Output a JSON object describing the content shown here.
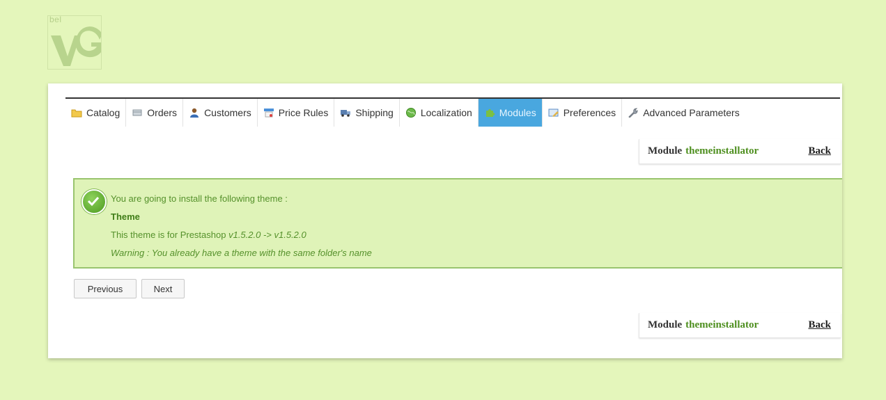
{
  "logo": {
    "text": "bel"
  },
  "tabs": [
    {
      "label": "Catalog",
      "icon": "folder-icon"
    },
    {
      "label": "Orders",
      "icon": "cart-icon"
    },
    {
      "label": "Customers",
      "icon": "user-icon"
    },
    {
      "label": "Price Rules",
      "icon": "price-tag-icon"
    },
    {
      "label": "Shipping",
      "icon": "truck-icon"
    },
    {
      "label": "Localization",
      "icon": "globe-icon"
    },
    {
      "label": "Modules",
      "icon": "puzzle-icon"
    },
    {
      "label": "Preferences",
      "icon": "preferences-icon"
    },
    {
      "label": "Advanced Parameters",
      "icon": "wrench-icon"
    }
  ],
  "active_tab": "Modules",
  "header_top": {
    "prefix": "Module",
    "module": "themeinstallator",
    "back": "Back"
  },
  "notice": {
    "line1": "You are going to install the following theme :",
    "title": "Theme",
    "line3_prefix": "This theme is for Prestashop",
    "line3_version": "v1.5.2.0 -> v1.5.2.0",
    "warning": "Warning : You already have a theme with the same folder's name"
  },
  "buttons": {
    "previous": "Previous",
    "next": "Next"
  },
  "header_bottom": {
    "prefix": "Module",
    "module": "themeinstallator",
    "back": "Back"
  },
  "colors": {
    "accent": "#49a7df",
    "success_text": "#55912b",
    "success_bg": "#dff3b8"
  }
}
